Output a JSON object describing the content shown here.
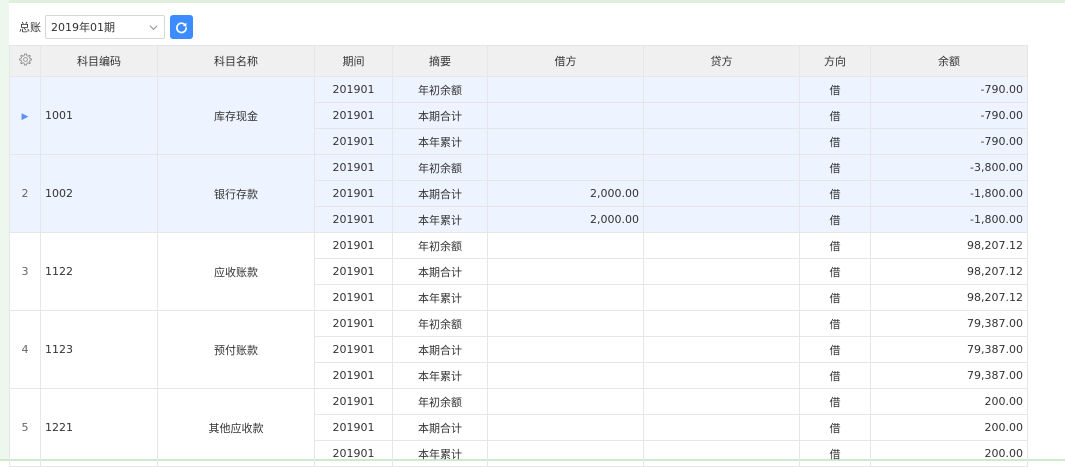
{
  "toolbar": {
    "ledger_label": "总账",
    "period_value": "2019年01期"
  },
  "columns": {
    "code": "科目编码",
    "name": "科目名称",
    "period": "期间",
    "summary": "摘要",
    "debit": "借方",
    "credit": "贷方",
    "direction": "方向",
    "balance": "余额"
  },
  "groups": [
    {
      "row_num": "",
      "code": "1001",
      "name": "库存现金",
      "rows": [
        {
          "period": "201901",
          "summary": "年初余额",
          "debit": "",
          "credit": "",
          "direction": "借",
          "balance": "-790.00"
        },
        {
          "period": "201901",
          "summary": "本期合计",
          "debit": "",
          "credit": "",
          "direction": "借",
          "balance": "-790.00"
        },
        {
          "period": "201901",
          "summary": "本年累计",
          "debit": "",
          "credit": "",
          "direction": "借",
          "balance": "-790.00"
        }
      ]
    },
    {
      "row_num": "2",
      "code": "1002",
      "name": "银行存款",
      "rows": [
        {
          "period": "201901",
          "summary": "年初余额",
          "debit": "",
          "credit": "",
          "direction": "借",
          "balance": "-3,800.00"
        },
        {
          "period": "201901",
          "summary": "本期合计",
          "debit": "2,000.00",
          "credit": "",
          "direction": "借",
          "balance": "-1,800.00"
        },
        {
          "period": "201901",
          "summary": "本年累计",
          "debit": "2,000.00",
          "credit": "",
          "direction": "借",
          "balance": "-1,800.00"
        }
      ]
    },
    {
      "row_num": "3",
      "code": "1122",
      "name": "应收账款",
      "rows": [
        {
          "period": "201901",
          "summary": "年初余额",
          "debit": "",
          "credit": "",
          "direction": "借",
          "balance": "98,207.12"
        },
        {
          "period": "201901",
          "summary": "本期合计",
          "debit": "",
          "credit": "",
          "direction": "借",
          "balance": "98,207.12"
        },
        {
          "period": "201901",
          "summary": "本年累计",
          "debit": "",
          "credit": "",
          "direction": "借",
          "balance": "98,207.12"
        }
      ]
    },
    {
      "row_num": "4",
      "code": "1123",
      "name": "预付账款",
      "rows": [
        {
          "period": "201901",
          "summary": "年初余额",
          "debit": "",
          "credit": "",
          "direction": "借",
          "balance": "79,387.00"
        },
        {
          "period": "201901",
          "summary": "本期合计",
          "debit": "",
          "credit": "",
          "direction": "借",
          "balance": "79,387.00"
        },
        {
          "period": "201901",
          "summary": "本年累计",
          "debit": "",
          "credit": "",
          "direction": "借",
          "balance": "79,387.00"
        }
      ]
    },
    {
      "row_num": "5",
      "code": "1221",
      "name": "其他应收款",
      "rows": [
        {
          "period": "201901",
          "summary": "年初余额",
          "debit": "",
          "credit": "",
          "direction": "借",
          "balance": "200.00"
        },
        {
          "period": "201901",
          "summary": "本期合计",
          "debit": "",
          "credit": "",
          "direction": "借",
          "balance": "200.00"
        },
        {
          "period": "201901",
          "summary": "本年累计",
          "debit": "",
          "credit": "",
          "direction": "借",
          "balance": "200.00"
        }
      ]
    }
  ],
  "icons": {
    "column_settings": "gear-icon",
    "period_dropdown": "chevron-down-icon",
    "refresh": "refresh-icon",
    "current_row": "row-pointer-icon"
  },
  "colors": {
    "accent": "#3d8cff",
    "selected_row": "#eef4ff",
    "header_bg": "#f0f0f0"
  }
}
